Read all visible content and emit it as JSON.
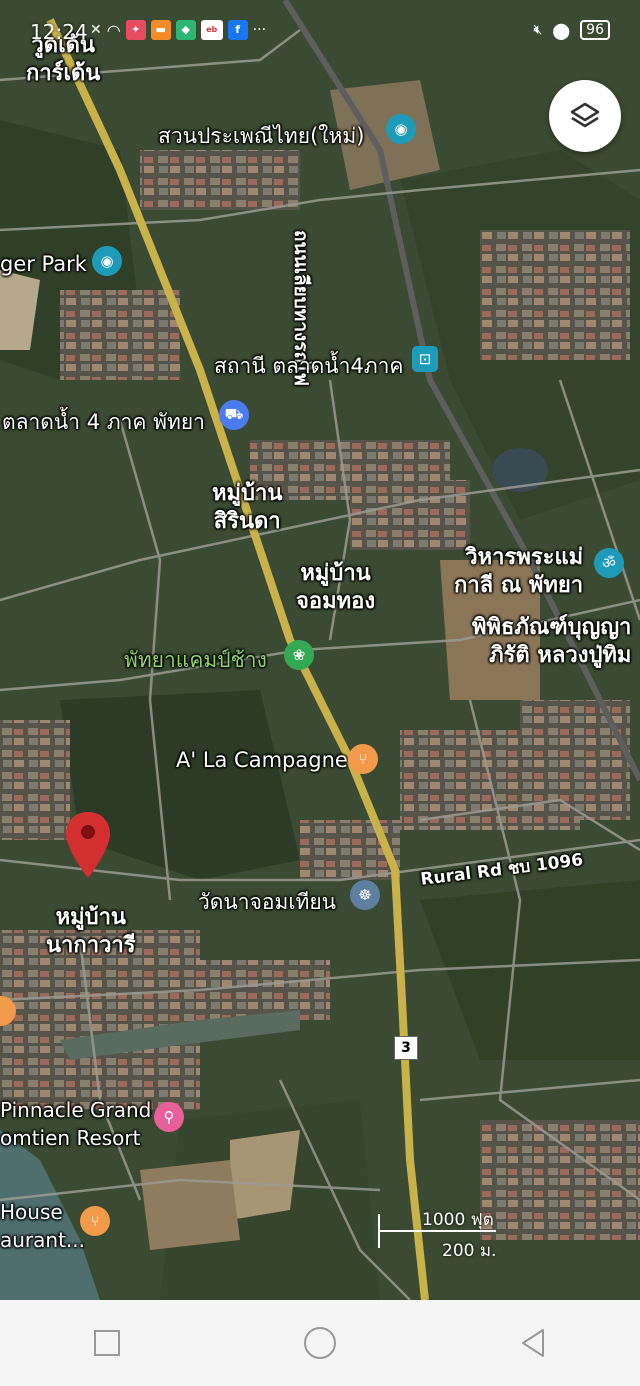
{
  "status_bar": {
    "time": "12:24",
    "battery": "96"
  },
  "places": {
    "wat_garden": "วูดเด้น\nการ์เด้น",
    "thai_tradition_park": "สวนประเพณีไทย(ใหม่)",
    "tiger_park": "ger Park",
    "railway_road": "ถนนเลียบทางรถไฟ",
    "floating_market_station": "สถานี ตลาดน้ำ4ภาค",
    "floating_market": "ตลาดน้ำ 4 ภาค พัทยา",
    "sirinda_village": "หมู่บ้าน\nสิรินดา",
    "jomthong_village": "หมู่บ้าน\nจอมทอง",
    "elephant_camp": "พัทยาแคมป์ช้าง",
    "virgin_mary_chapel": "วิหารพระแม่\nกาลี ณ พัทยา",
    "museum": "พิพิธภัณฑ์บุญญา\nภิรัติ หลวงปู่ทิม",
    "la_campagne": "A' La Campagne",
    "rural_road": "Rural Rd ชบ 1096",
    "wat_najomtien": "วัดนาจอมเทียน",
    "nakawari_village": "หมู่บ้าน\nนากาวารี",
    "pinnacle_resort": "Pinnacle Grand\nomtien Resort",
    "house_restaurant": "House\naurant..."
  },
  "route_shield": "3",
  "scale": {
    "feet": "1000 ฟุต",
    "meters": "200 ม."
  },
  "colors": {
    "highway": "#c9b24a",
    "pin_red": "#d32f2f",
    "camera_pin": "#1e9bb8",
    "shopping_pin": "#4a7cf0",
    "food_pin": "#f2994a",
    "park_pin": "#34a853",
    "hotel_pin": "#e8609a"
  }
}
